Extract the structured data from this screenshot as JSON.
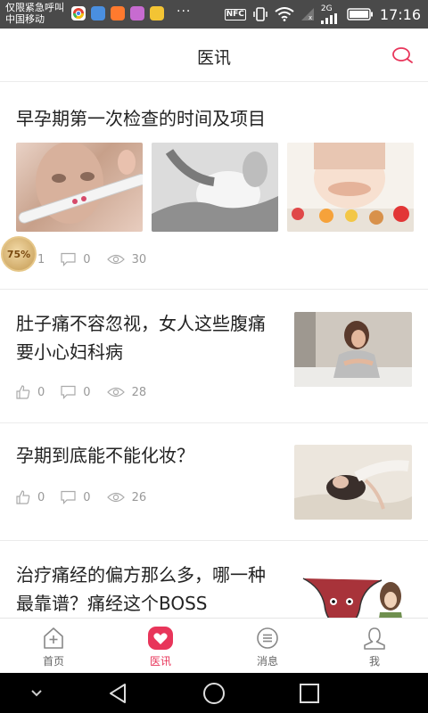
{
  "status_bar": {
    "carrier_line1": "仅限紧急呼叫",
    "carrier_line2": "中国移动",
    "more": "···",
    "nfc": "NFC",
    "net": "2G",
    "time": "17:16",
    "app_icon_colors": [
      "#ffffff",
      "#4a8fe0",
      "#ff7a2e",
      "#c76bd0",
      "#f3c434"
    ]
  },
  "header": {
    "title": "医讯"
  },
  "articles": [
    {
      "title": "早孕期第一次检查的时间及项目",
      "likes": "1",
      "comments": "0",
      "views": "30",
      "overlay_badge": "75%"
    },
    {
      "title": "肚子痛不容忽视，女人这些腹痛要小心妇科病",
      "likes": "0",
      "comments": "0",
      "views": "28"
    },
    {
      "title": "孕期到底能不能化妆？",
      "likes": "0",
      "comments": "0",
      "views": "26"
    },
    {
      "title": "治疗痛经的偏方那么多，哪一种最靠谱？痛经这个BOSS"
    }
  ],
  "tabbar": {
    "tabs": [
      {
        "label": "首页",
        "icon": "home-icon"
      },
      {
        "label": "医讯",
        "icon": "heart-icon"
      },
      {
        "label": "消息",
        "icon": "message-icon"
      },
      {
        "label": "我",
        "icon": "user-icon"
      }
    ],
    "active": "医讯",
    "accent": "#e8355a"
  }
}
